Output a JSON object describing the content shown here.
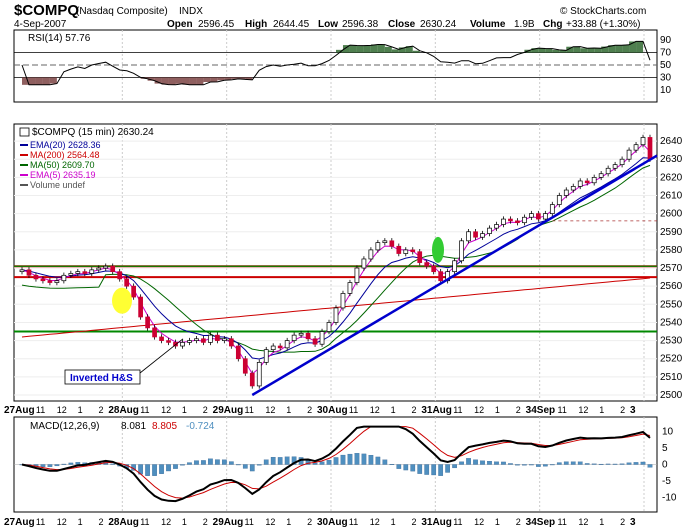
{
  "header": {
    "symbol": "$COMPQ",
    "name": "(Nasdaq Composite)",
    "exchange": "INDX",
    "date": "4-Sep-2007",
    "open_label": "Open",
    "open": "2596.45",
    "high_label": "High",
    "high": "2644.45",
    "low_label": "Low",
    "low": "2596.38",
    "close_label": "Close",
    "close": "2630.24",
    "volume_label": "Volume",
    "volume": "1.9B",
    "chg_label": "Chg",
    "chg": "+33.88 (+1.30%)",
    "watermark": "© StockCharts.com"
  },
  "rsi": {
    "label": "RSI(14) 57.76",
    "levels": [
      90,
      70,
      50,
      30,
      10
    ],
    "tick_labels": [
      "90",
      "70",
      "50",
      "30",
      "10"
    ]
  },
  "price": {
    "title": "$COMPQ (15 min) 2630.24",
    "legend": [
      {
        "text": "EMA(20) 2628.36",
        "color": "#000099"
      },
      {
        "text": "MA(200) 2564.48",
        "color": "#cc0000"
      },
      {
        "text": "MA(50) 2609.70",
        "color": "#006600"
      },
      {
        "text": "EMA(5) 2635.19",
        "color": "#cc00cc"
      },
      {
        "text": "Volume undef",
        "color": "#555555"
      }
    ],
    "annotation": "Inverted H&S",
    "y_ticks": [
      "2640",
      "2630",
      "2620",
      "2610",
      "2600",
      "2590",
      "2580",
      "2570",
      "2560",
      "2550",
      "2540",
      "2530",
      "2520",
      "2510",
      "2500"
    ]
  },
  "macd": {
    "label": "MACD(12,26,9)",
    "macd_value": "8.081",
    "signal_value": "8.805",
    "hist_value": "-0.724",
    "y_ticks": [
      "10",
      "5",
      "0",
      "-5",
      "-10"
    ]
  },
  "x_axis": {
    "labels": [
      "27Aug",
      "11",
      "12",
      "1",
      "2",
      "28Aug",
      "11",
      "12",
      "1",
      "2",
      "29Aug",
      "11",
      "12",
      "1",
      "2",
      "30Aug",
      "11",
      "12",
      "1",
      "2",
      "31Aug",
      "11",
      "12",
      "1",
      "2",
      "34Sep",
      "11",
      "12",
      "1",
      "2",
      "3"
    ]
  },
  "colors": {
    "up": "#ffffff",
    "down": "#cc0033",
    "ema20": "#000099",
    "ma200": "#cc0000",
    "ma50": "#006600",
    "ema5": "#cc00cc",
    "trend": "#0000cc",
    "resistance": "#cc0000",
    "support": "#008800",
    "hist": "#4f8fbf",
    "rsi_fill": "#4f7f4f",
    "rsi_fill_low": "#8f5f5f",
    "highlight_yellow": "#ffff33",
    "highlight_green": "#33cc33"
  },
  "chart_data": {
    "type": "candlestick",
    "interval": "15 min",
    "sessions": [
      "27Aug",
      "28Aug",
      "29Aug",
      "30Aug",
      "31Aug",
      "4Sep"
    ],
    "ylim": [
      2500,
      2645
    ],
    "close_series": [
      2569,
      2566,
      2564,
      2563,
      2562,
      2563,
      2566,
      2567,
      2568,
      2567,
      2569,
      2570,
      2571,
      2568,
      2564,
      2560,
      2554,
      2543,
      2537,
      2532,
      2530,
      2529,
      2527,
      2529,
      2530,
      2531,
      2529,
      2533,
      2530,
      2531,
      2527,
      2520,
      2512,
      2505,
      2518,
      2525,
      2527,
      2526,
      2530,
      2533,
      2534,
      2531,
      2528,
      2535,
      2540,
      2548,
      2556,
      2562,
      2570,
      2575,
      2580,
      2584,
      2585,
      2582,
      2578,
      2580,
      2579,
      2573,
      2571,
      2568,
      2563,
      2568,
      2574,
      2585,
      2590,
      2587,
      2589,
      2592,
      2594,
      2597,
      2596,
      2595,
      2598,
      2600,
      2597,
      2600,
      2605,
      2610,
      2613,
      2615,
      2618,
      2617,
      2620,
      2622,
      2625,
      2627,
      2630,
      2635,
      2638,
      2642,
      2630
    ],
    "resistance_levels": [
      2571,
      2565
    ],
    "support_level": 2535,
    "trendline": {
      "from": {
        "x": "29Aug 10:30",
        "y": 2500
      },
      "to": {
        "x": "4Sep 4:00",
        "y": 2632
      }
    },
    "rsi_last": 57.76,
    "macd_last": {
      "macd": 8.081,
      "signal": 8.805,
      "histogram": -0.724
    }
  }
}
